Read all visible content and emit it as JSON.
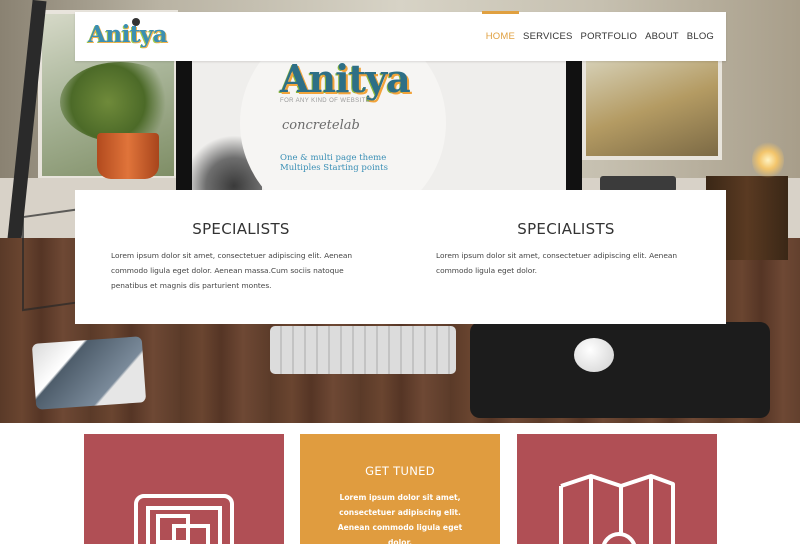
{
  "hero": {
    "screen_logo": "Anitya",
    "screen_subtitle": "FOR ANY KIND OF WEBSITE",
    "screen_script": "concretelab",
    "screen_tagline_1": "One & multi page theme",
    "screen_tagline_2": "Multiples Starting points"
  },
  "navbar": {
    "brand": "Anitya",
    "items": [
      {
        "label": "HOME",
        "active": true
      },
      {
        "label": "SERVICES",
        "active": false
      },
      {
        "label": "PORTFOLIO",
        "active": false
      },
      {
        "label": "ABOUT",
        "active": false
      },
      {
        "label": "BLOG",
        "active": false
      }
    ]
  },
  "features": [
    {
      "title": "SPECIALISTS",
      "text": "Lorem ipsum dolor sit amet, consectetuer adipiscing elit. Aenean commodo ligula eget dolor. Aenean massa.Cum sociis natoque penatibus et magnis dis parturient montes."
    },
    {
      "title": "SPECIALISTS",
      "text": "Lorem ipsum dolor sit amet, consectetuer adipiscing elit. Aenean commodo ligula eget dolor."
    }
  ],
  "cards": [
    {
      "icon": "gallery-icon"
    },
    {
      "title": "GET TUNED",
      "text": "Lorem ipsum dolor sit amet, consectetuer adipiscing elit. Aenean commodo ligula eget dolor."
    },
    {
      "icon": "map-pin-icon"
    }
  ],
  "colors": {
    "accent": "#e0a040",
    "card_red": "#b04f55",
    "card_orange": "#e09c3f"
  }
}
